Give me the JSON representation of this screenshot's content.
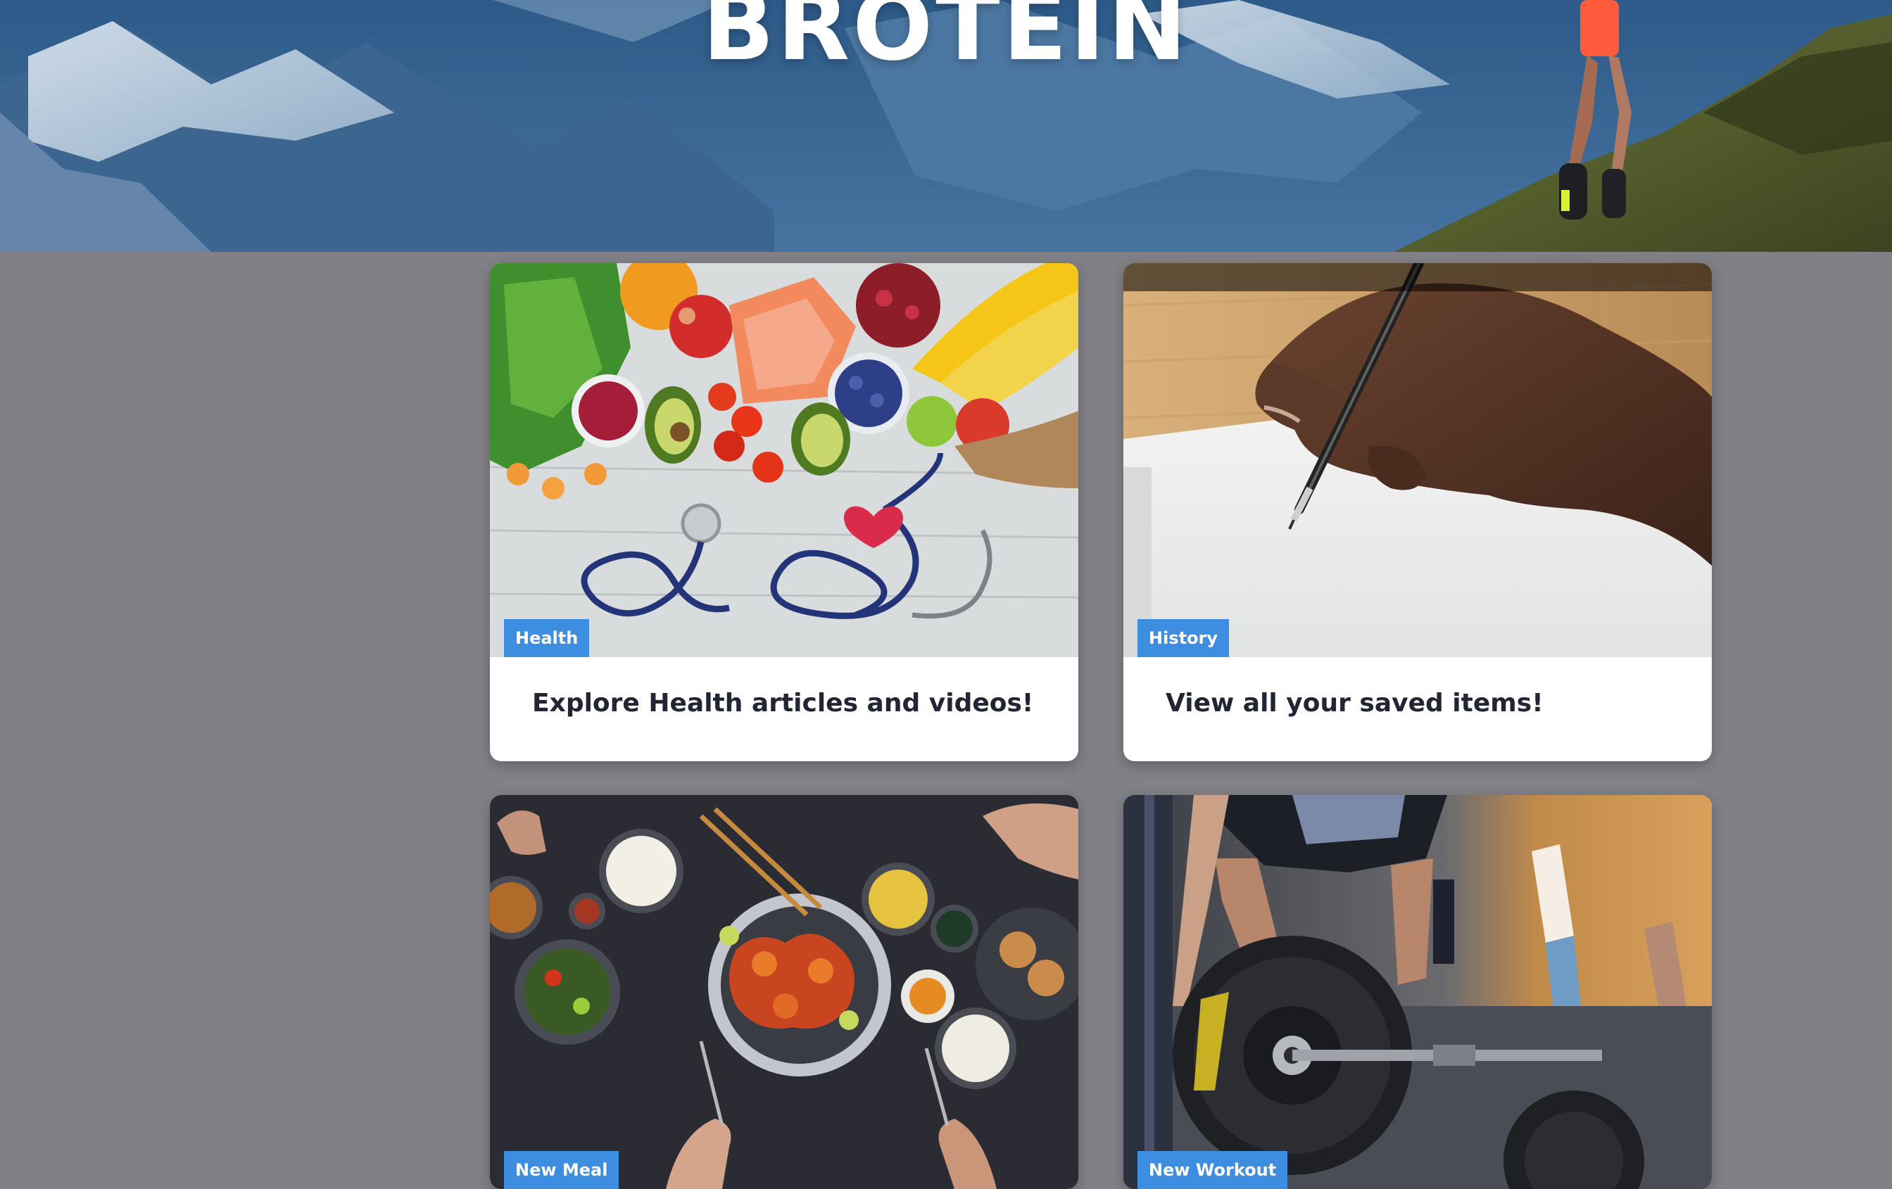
{
  "brand": {
    "title": "BROTEIN"
  },
  "cards": [
    {
      "tag": "Health",
      "title": "Explore Health articles and videos!",
      "image": "healthy-food-stethoscope-image"
    },
    {
      "tag": "History",
      "title": "View all your saved items!",
      "image": "hand-writing-pen-image"
    },
    {
      "tag": "New Meal",
      "tag_label": "New Meal",
      "title": "",
      "image": "shared-meal-table-image"
    },
    {
      "tag": "New Workout",
      "title": "",
      "image": "barbell-workout-image"
    }
  ],
  "colors": {
    "page_background": "#818086",
    "tag_background": "#3d8de0",
    "card_background": "#ffffff",
    "title_text": "#222533"
  }
}
